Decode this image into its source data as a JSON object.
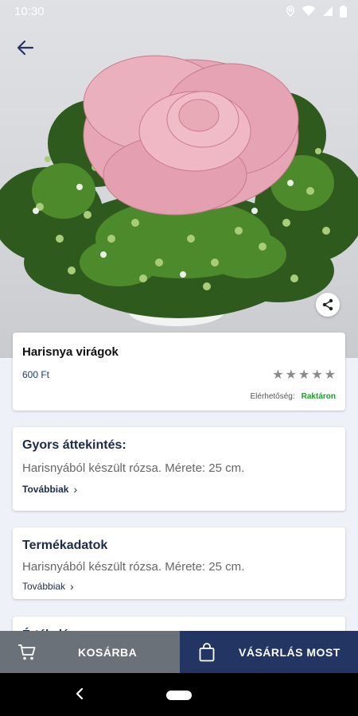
{
  "status_bar": {
    "time": "10:30",
    "icons": [
      "location-icon",
      "wifi-icon",
      "signal-icon",
      "battery-icon"
    ]
  },
  "hero": {
    "icons": {
      "back": "arrow-left-icon",
      "share": "share-icon"
    }
  },
  "product": {
    "name": "Harisnya virágok",
    "price": "600 Ft",
    "rating": {
      "value": 0,
      "max": 5
    },
    "availability_label": "Elérhetőség:",
    "availability_value": "Raktáron"
  },
  "quick_overview": {
    "title": "Gyors áttekintés:",
    "body": "Harisnyából készült rózsa. Mérete: 25 cm.",
    "more": "Továbbiak"
  },
  "product_data": {
    "title": "Termékadatok",
    "body": "Harisnyából készült rózsa. Mérete: 25 cm.",
    "more": "Továbbiak"
  },
  "third_section": {
    "title": "Értékelés"
  },
  "bottom_bar": {
    "cart_label": "KOSÁRBA",
    "buy_label": "VÁSÁRLÁS MOST"
  },
  "colors": {
    "primary": "#233563",
    "secondary_button": "#6b7179",
    "in_stock": "#1f9a2c",
    "background": "#eef1f7"
  }
}
